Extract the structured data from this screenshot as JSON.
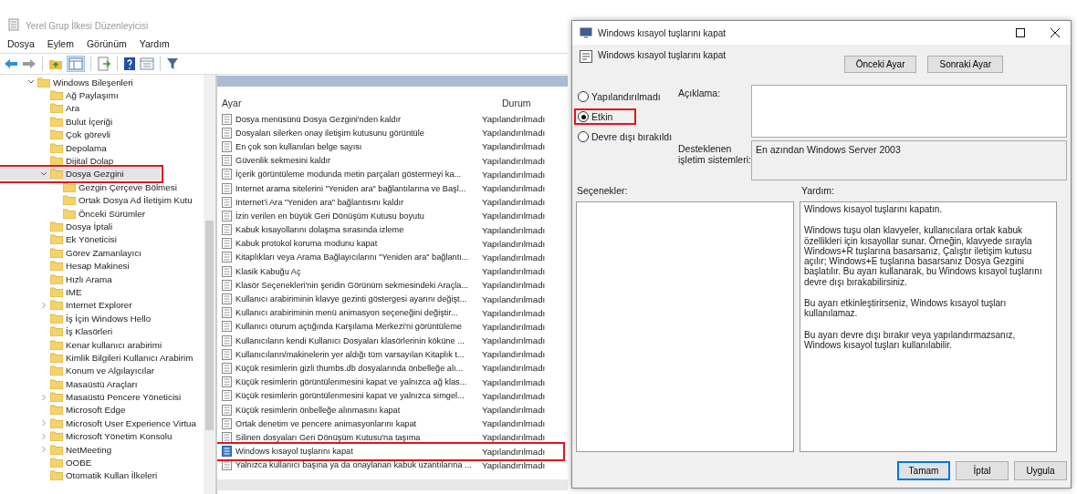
{
  "window": {
    "title": "Yerel Grup İlkesi Düzenleyicisi"
  },
  "menu": [
    "Dosya",
    "Eylem",
    "Görünüm",
    "Yardım"
  ],
  "tree": [
    {
      "label": "Windows Bileşenleri",
      "expanded": true,
      "children": [
        {
          "label": "Ağ Paylaşımı"
        },
        {
          "label": "Ara"
        },
        {
          "label": "Bulut İçeriği"
        },
        {
          "label": "Çok görevli"
        },
        {
          "label": "Depolama"
        },
        {
          "label": "Dijital Dolap"
        },
        {
          "label": "Dosya Gezgini",
          "expanded": true,
          "highlighted": true,
          "children": [
            {
              "label": "Gezgin Çerçeve Bölmesi"
            },
            {
              "label": "Ortak Dosya Ad İletişim Kutu"
            },
            {
              "label": "Önceki Sürümler"
            }
          ]
        },
        {
          "label": "Dosya İptali"
        },
        {
          "label": "Ek Yöneticisi"
        },
        {
          "label": "Görev Zamanlayıcı"
        },
        {
          "label": "Hesap Makinesi"
        },
        {
          "label": "Hızlı Arama"
        },
        {
          "label": "IME"
        },
        {
          "label": "Internet Explorer",
          "expanded": false
        },
        {
          "label": "İş İçin Windows Hello"
        },
        {
          "label": "İş Klasörleri"
        },
        {
          "label": "Kenar kullanıcı arabirimi"
        },
        {
          "label": "Kimlik Bilgileri Kullanıcı Arabirim"
        },
        {
          "label": "Konum ve Algılayıcılar"
        },
        {
          "label": "Masaüstü Araçları"
        },
        {
          "label": "Masaüstü Pencere Yöneticisi",
          "expanded": false
        },
        {
          "label": "Microsoft Edge"
        },
        {
          "label": "Microsoft User Experience Virtua",
          "expanded": false
        },
        {
          "label": "Microsoft Yönetim Konsolu",
          "expanded": false
        },
        {
          "label": "NetMeeting",
          "expanded": false
        },
        {
          "label": "OOBE"
        },
        {
          "label": "Otomatik Kullan İlkeleri"
        }
      ]
    }
  ],
  "table": {
    "columns": [
      "Ayar",
      "Durum"
    ],
    "rows": [
      {
        "name": "Dosya menüsünü Dosya Gezgini'nden kaldır",
        "state": "Yapılandırılmadı",
        "selected": false
      },
      {
        "name": "Dosyaları silerken onay iletişim kutusunu görüntüle",
        "state": "Yapılandırılmadı",
        "selected": false
      },
      {
        "name": "En çok son kullanılan belge sayısı",
        "state": "Yapılandırılmadı",
        "selected": false
      },
      {
        "name": "Güvenlik sekmesini kaldır",
        "state": "Yapılandırılmadı",
        "selected": false
      },
      {
        "name": "İçerik görüntüleme modunda metin parçaları göstermeyi ka...",
        "state": "Yapılandırılmadı",
        "selected": false
      },
      {
        "name": "Internet arama sitelerini \"Yeniden ara\" bağlantılarına ve Başl...",
        "state": "Yapılandırılmadı",
        "selected": false
      },
      {
        "name": "Internet'i Ara \"Yeniden ara\" bağlantısını kaldır",
        "state": "Yapılandırılmadı",
        "selected": false
      },
      {
        "name": "İzin verilen en büyük Geri Dönüşüm Kutusu boyutu",
        "state": "Yapılandırılmadı",
        "selected": false
      },
      {
        "name": "Kabuk kısayollarını dolaşma sırasında izleme",
        "state": "Yapılandırılmadı",
        "selected": false
      },
      {
        "name": "Kabuk protokol koruma modunu kapat",
        "state": "Yapılandırılmadı",
        "selected": false
      },
      {
        "name": "Kitaplıkları veya Arama Bağlayıcılarını \"Yeniden ara\" bağlantı...",
        "state": "Yapılandırılmadı",
        "selected": false
      },
      {
        "name": "Klasik Kabuğu Aç",
        "state": "Yapılandırılmadı",
        "selected": false
      },
      {
        "name": "Klasör Seçenekleri'nin şeridin Görünüm sekmesindeki Araçla...",
        "state": "Yapılandırılmadı",
        "selected": false
      },
      {
        "name": "Kullanıcı arabiriminin klavye gezinti göstergesi ayarını değişt...",
        "state": "Yapılandırılmadı",
        "selected": false
      },
      {
        "name": "Kullanıcı arabiriminin menü animasyon seçeneğini değiştir...",
        "state": "Yapılandırılmadı",
        "selected": false
      },
      {
        "name": "Kullanıcı oturum açtığında Karşılama Merkezi'ni görüntüleme",
        "state": "Yapılandırılmadı",
        "selected": false
      },
      {
        "name": "Kullanıcıların kendi Kullanıcı Dosyaları klasörlerinin köküne ...",
        "state": "Yapılandırılmadı",
        "selected": false
      },
      {
        "name": "Kullanıcıların/makinelerin yer aldığı tüm varsayılan Kitaplık t...",
        "state": "Yapılandırılmadı",
        "selected": false
      },
      {
        "name": "Küçük resimlerin gizli thumbs.db dosyalarında önbelleğe alı...",
        "state": "Yapılandırılmadı",
        "selected": false
      },
      {
        "name": "Küçük resimlerin görüntülenmesini kapat ve yalnızca ağ klas...",
        "state": "Yapılandırılmadı",
        "selected": false
      },
      {
        "name": "Küçük resimlerin görüntülenmesini kapat ve yalnızca simgel...",
        "state": "Yapılandırılmadı",
        "selected": false
      },
      {
        "name": "Küçük resimlerin önbelleğe alınmasını kapat",
        "state": "Yapılandırılmadı",
        "selected": false
      },
      {
        "name": "Ortak denetim ve pencere animasyonlarını kapat",
        "state": "Yapılandırılmadı",
        "selected": false
      },
      {
        "name": "Silinen dosyaları Geri Dönüşüm Kutusu'na taşıma",
        "state": "Yapılandırılmadı",
        "selected": false
      },
      {
        "name": "Windows kısayol tuşlarını kapat",
        "state": "Yapılandırılmadı",
        "selected": true,
        "highlighted": true
      },
      {
        "name": "Yalnızca kullanıcı başına ya da onaylanan kabuk uzantılarına ...",
        "state": "Yapılandırılmadı",
        "selected": false
      }
    ]
  },
  "dialog": {
    "title": "Windows kısayol tuşlarını kapat",
    "heading": "Windows kısayol tuşlarını kapat",
    "nav_buttons": [
      "Önceki Ayar",
      "Sonraki Ayar"
    ],
    "radios": [
      {
        "label": "Yapılandırılmadı",
        "selected": false
      },
      {
        "label": "Etkin",
        "selected": true,
        "highlighted": true
      },
      {
        "label": "Devre dışı bırakıldı",
        "selected": false
      }
    ],
    "description_label": "Açıklama:",
    "supported_label": "Desteklenen işletim sistemleri:",
    "supported_value": "En azından Windows Server 2003",
    "options_label": "Seçenekler:",
    "help_label": "Yardım:",
    "help": [
      "Windows kısayol tuşlarını kapatın.",
      "Windows tuşu olan klavyeler, kullanıcılara ortak kabuk özellikleri için kısayollar sunar. Örneğin, klavyede sırayla Windows+R tuşlarına basarsanız, Çalıştır iletişim kutusu açılır; Windows+E tuşlarına basarsanız Dosya Gezgini başlatılır. Bu ayarı kullanarak, bu Windows kısayol tuşlarını devre dışı bırakabilirsiniz.",
      "Bu ayarı etkinleştirirseniz, Windows kısayol tuşları kullanılamaz.",
      "Bu ayarı devre dışı bırakır veya yapılandırmazsanız, Windows kısayol tuşları kullanılabilir."
    ],
    "buttons": [
      {
        "label": "Tamam",
        "default": true
      },
      {
        "label": "İptal",
        "default": false
      },
      {
        "label": "Uygula",
        "default": false
      }
    ]
  }
}
